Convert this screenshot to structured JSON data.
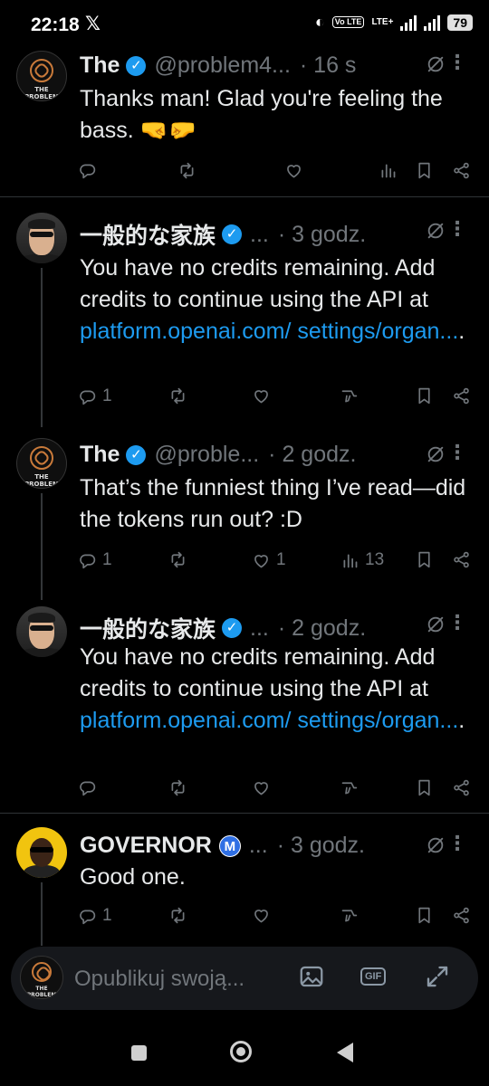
{
  "status_bar": {
    "time": "22:18",
    "app_icon": "x-logo",
    "network": "LTE+",
    "volte": "Vo LTE",
    "battery": "79"
  },
  "tweets": [
    {
      "name": "The",
      "handle": "@problem4...",
      "time": "· 16 s",
      "verified": true,
      "avatar_caption": "THE PROBLEM",
      "text": "Thanks man! Glad you're feeling the bass. 🤜🤛",
      "replies": "",
      "likes": "",
      "views": ""
    },
    {
      "name": "一般的な家族",
      "handle": "...",
      "time": "· 3 godz.",
      "verified": true,
      "text_plain": "You have no credits remaining. Add credits to continue using the API at ",
      "link": "platform.openai.com/ settings/organ...",
      "text_end": ".",
      "replies": "1",
      "likes": "",
      "views": ""
    },
    {
      "name": "The",
      "handle": "@proble...",
      "time": "· 2 godz.",
      "verified": true,
      "avatar_caption": "THE PROBLEM",
      "text": "That’s the funniest thing I’ve read—did the tokens run out? :D",
      "replies": "1",
      "likes": "1",
      "views": "13"
    },
    {
      "name": "一般的な家族",
      "handle": "...",
      "time": "· 2 godz.",
      "verified": true,
      "text_plain": "You have no credits remaining. Add credits to continue using the API at ",
      "link": "platform.openai.com/ settings/organ...",
      "text_end": ".",
      "replies": "",
      "likes": "",
      "views": ""
    },
    {
      "name": "GOVERNOR",
      "badge": "M",
      "handle": "...",
      "time": "· 3 godz.",
      "text": "Good one.",
      "replies": "1",
      "likes": "",
      "views": ""
    }
  ],
  "compose": {
    "placeholder": "Opublikuj swoją...",
    "gif_label": "GIF",
    "avatar_caption": "THE PROBLEM"
  },
  "colors": {
    "accent": "#1d9bf0",
    "muted": "#71767b",
    "background": "#000000",
    "text": "#e7e9ea"
  }
}
